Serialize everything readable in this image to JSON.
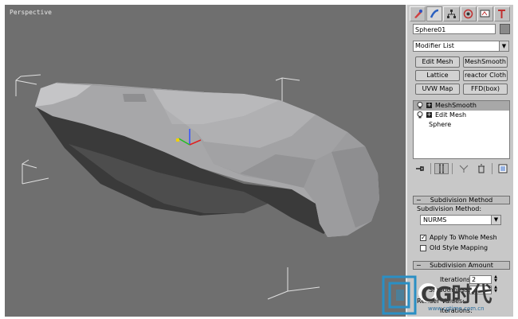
{
  "viewport": {
    "label": "Perspective"
  },
  "command_panel": {
    "tabs": [
      "create-icon",
      "modify-icon",
      "hierarchy-icon",
      "motion-icon",
      "display-icon",
      "utilities-icon"
    ],
    "object_name": "Sphere01",
    "modifier_list": "Modifier List",
    "buttons": [
      "Edit Mesh",
      "MeshSmooth",
      "Lattice",
      "reactor Cloth",
      "UVW Map",
      "FFD(box)"
    ],
    "stack": [
      {
        "label": "MeshSmooth",
        "selected": true
      },
      {
        "label": "Edit Mesh",
        "selected": false
      },
      {
        "label": "Sphere",
        "selected": false
      }
    ],
    "subdivision_method": {
      "title": "Subdivision Method",
      "label": "Subdivision Method:",
      "value": "NURMS",
      "apply_whole_mesh": "Apply To Whole Mesh",
      "old_style": "Old Style Mapping"
    },
    "subdivision_amount": {
      "title": "Subdivision Amount",
      "iterations_label": "Iterations:",
      "iterations_value": "2",
      "smoothness_label": "Smoothness:",
      "render_values": "Render Values:",
      "render_iterations": "Iterations:"
    }
  },
  "watermark": {
    "text": "CG时代",
    "url": "www.cgtime.com.cn"
  },
  "colors": {
    "viewport_bg": "#6f6f6f",
    "panel_bg": "#c8c8c8",
    "watermark_blue": "#2a8fc4"
  }
}
